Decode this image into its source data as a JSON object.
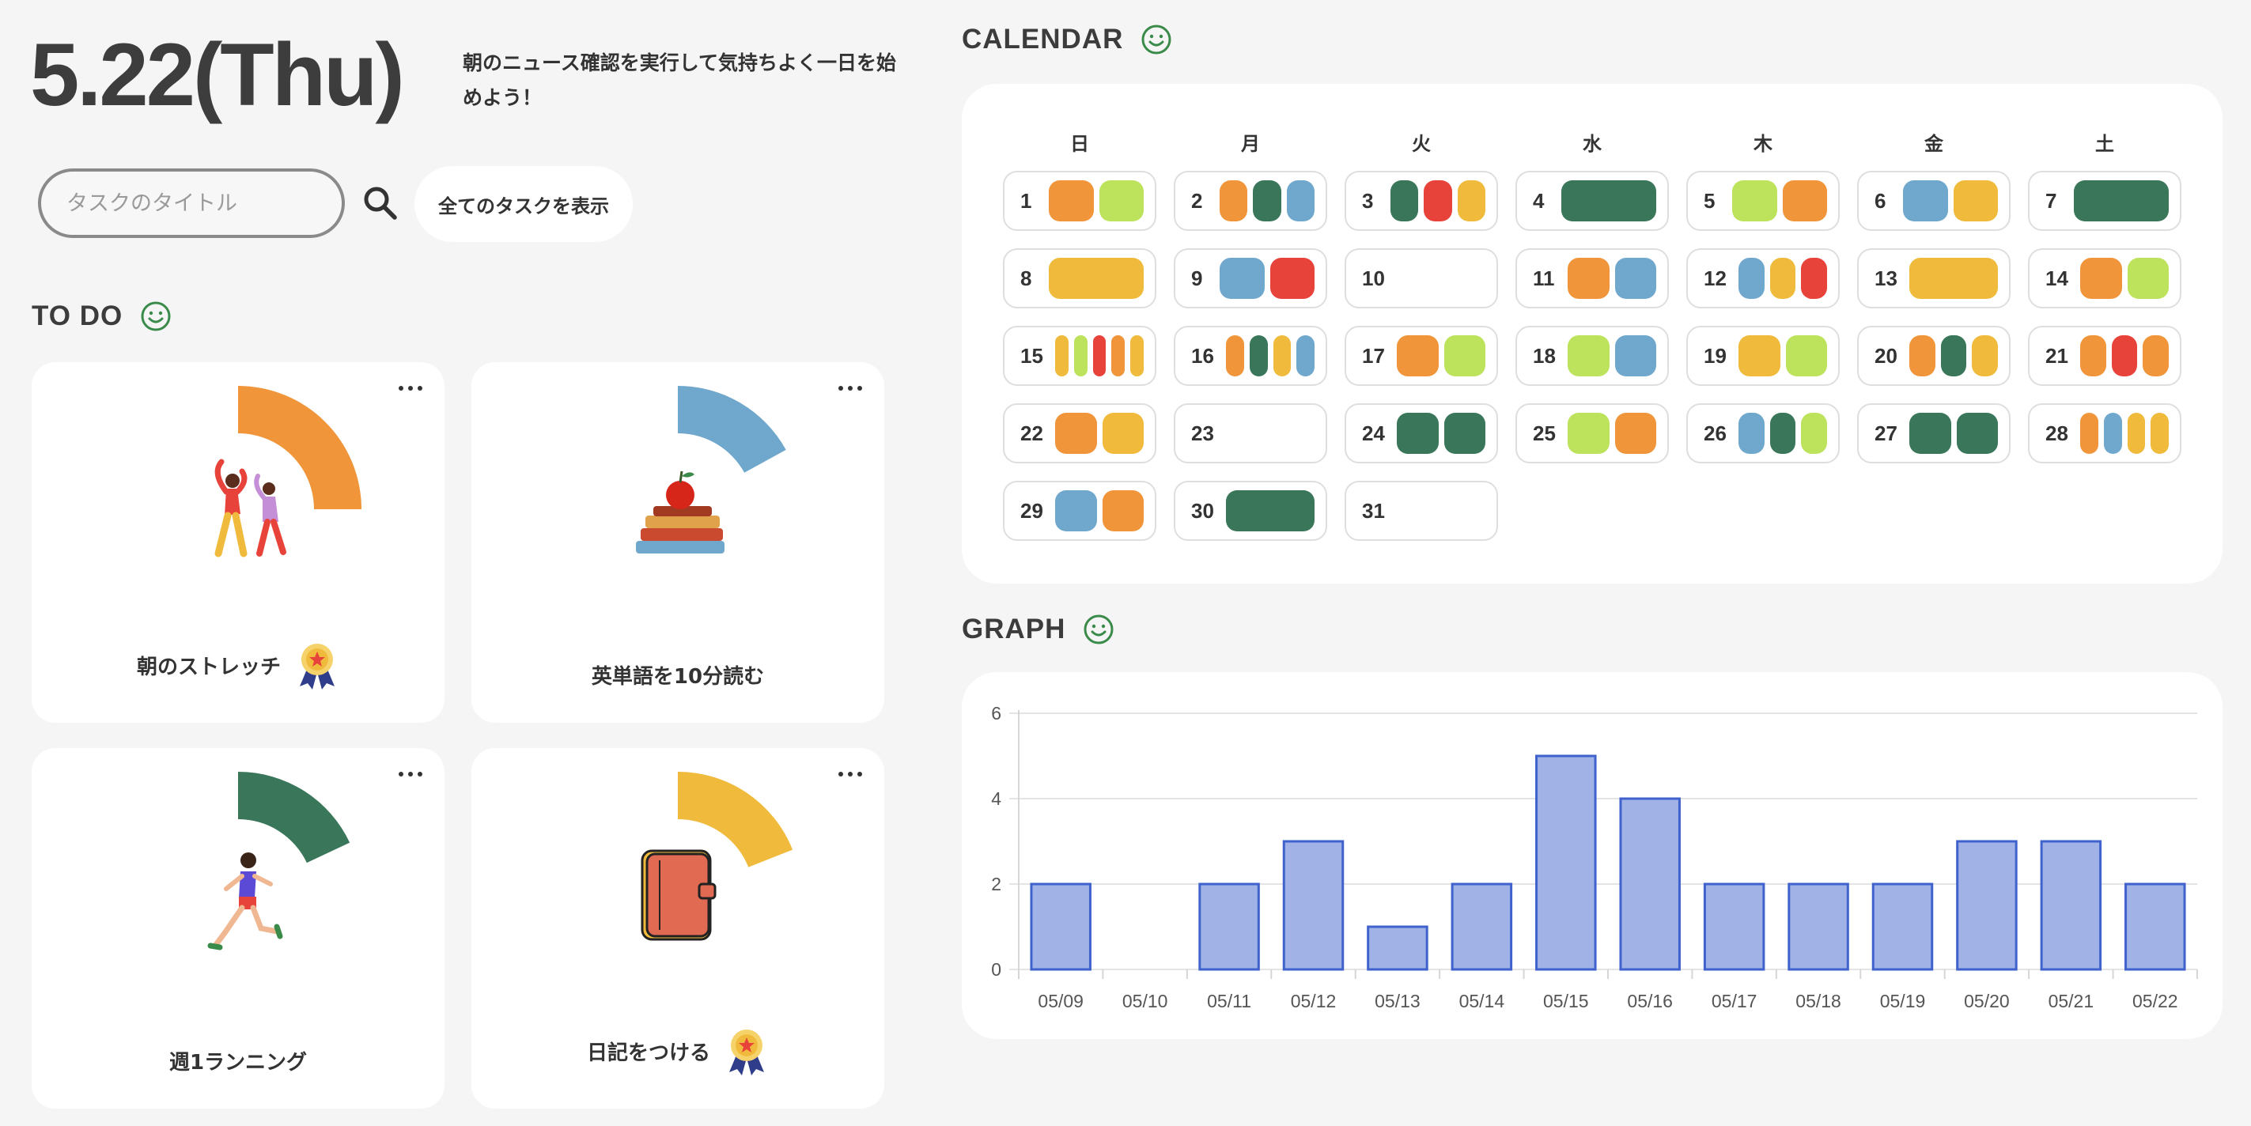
{
  "header": {
    "date": "5.22(Thu)",
    "message": "朝のニュース確認を実行して気持ちよく一日を始めよう！"
  },
  "search": {
    "placeholder": "タスクのタイトル",
    "icon": "search-icon",
    "show_all_label": "全てのタスクを表示"
  },
  "todo": {
    "title": "TO DO",
    "icon": "smile-icon",
    "more_icon": "more-icon",
    "tasks": [
      {
        "label": "朝のストレッチ",
        "color": "#f0953a",
        "progress": 0.25,
        "illustration": "stretching-people-illustration",
        "medal": true
      },
      {
        "label": "英単語を10分読む",
        "color": "#6fa8cc",
        "progress": 0.17,
        "illustration": "books-and-apple-illustration",
        "medal": false
      },
      {
        "label": "週1ランニング",
        "color": "#3a775a",
        "progress": 0.18,
        "illustration": "runner-illustration",
        "medal": false
      },
      {
        "label": "日記をつける",
        "color": "#f0bb3c",
        "progress": 0.19,
        "illustration": "diary-illustration",
        "medal": true
      }
    ]
  },
  "calendar": {
    "title": "CALENDAR",
    "icon": "smile-icon",
    "weekdays": [
      "日",
      "月",
      "火",
      "水",
      "木",
      "金",
      "土"
    ],
    "colors": {
      "orange": "#f0953a",
      "lime": "#bde35c",
      "green": "#3a775a",
      "blue": "#6fa8cc",
      "red": "#e8433a",
      "yellow": "#f0bb3c"
    },
    "days": [
      {
        "day": "1",
        "tasks": [
          "orange",
          "lime"
        ]
      },
      {
        "day": "2",
        "tasks": [
          "orange",
          "green",
          "blue"
        ]
      },
      {
        "day": "3",
        "tasks": [
          "green",
          "red",
          "yellow"
        ]
      },
      {
        "day": "4",
        "tasks": [
          "green"
        ]
      },
      {
        "day": "5",
        "tasks": [
          "lime",
          "orange"
        ]
      },
      {
        "day": "6",
        "tasks": [
          "blue",
          "yellow"
        ]
      },
      {
        "day": "7",
        "tasks": [
          "green"
        ]
      },
      {
        "day": "8",
        "tasks": [
          "yellow"
        ]
      },
      {
        "day": "9",
        "tasks": [
          "blue",
          "red"
        ]
      },
      {
        "day": "10",
        "tasks": []
      },
      {
        "day": "11",
        "tasks": [
          "orange",
          "blue"
        ]
      },
      {
        "day": "12",
        "tasks": [
          "blue",
          "yellow",
          "red"
        ]
      },
      {
        "day": "13",
        "tasks": [
          "yellow"
        ]
      },
      {
        "day": "14",
        "tasks": [
          "orange",
          "lime"
        ]
      },
      {
        "day": "15",
        "tasks": [
          "yellow",
          "lime",
          "red",
          "orange",
          "yellow"
        ]
      },
      {
        "day": "16",
        "tasks": [
          "orange",
          "green",
          "yellow",
          "blue"
        ]
      },
      {
        "day": "17",
        "tasks": [
          "orange",
          "lime"
        ]
      },
      {
        "day": "18",
        "tasks": [
          "lime",
          "blue"
        ]
      },
      {
        "day": "19",
        "tasks": [
          "yellow",
          "lime"
        ]
      },
      {
        "day": "20",
        "tasks": [
          "orange",
          "green",
          "yellow"
        ]
      },
      {
        "day": "21",
        "tasks": [
          "orange",
          "red",
          "orange"
        ]
      },
      {
        "day": "22",
        "tasks": [
          "orange",
          "yellow"
        ]
      },
      {
        "day": "23",
        "tasks": []
      },
      {
        "day": "24",
        "tasks": [
          "green",
          "green"
        ]
      },
      {
        "day": "25",
        "tasks": [
          "lime",
          "orange"
        ]
      },
      {
        "day": "26",
        "tasks": [
          "blue",
          "green",
          "lime"
        ]
      },
      {
        "day": "27",
        "tasks": [
          "green",
          "green"
        ]
      },
      {
        "day": "28",
        "tasks": [
          "orange",
          "blue",
          "yellow",
          "yellow"
        ]
      },
      {
        "day": "29",
        "tasks": [
          "blue",
          "orange"
        ]
      },
      {
        "day": "30",
        "tasks": [
          "green"
        ]
      },
      {
        "day": "31",
        "tasks": []
      }
    ]
  },
  "graph": {
    "title": "GRAPH",
    "icon": "smile-icon"
  },
  "chart_data": {
    "type": "bar",
    "categories": [
      "05/09",
      "05/10",
      "05/11",
      "05/12",
      "05/13",
      "05/14",
      "05/15",
      "05/16",
      "05/17",
      "05/18",
      "05/19",
      "05/20",
      "05/21",
      "05/22"
    ],
    "values": [
      2,
      0,
      2,
      3,
      1,
      2,
      5,
      4,
      2,
      2,
      2,
      3,
      3,
      2
    ],
    "ylim": [
      0,
      6
    ],
    "yticks": [
      "0",
      "2",
      "4",
      "6"
    ],
    "grid": true,
    "bar_fill": "#a0b2e6",
    "bar_stroke": "#3f62cc"
  }
}
